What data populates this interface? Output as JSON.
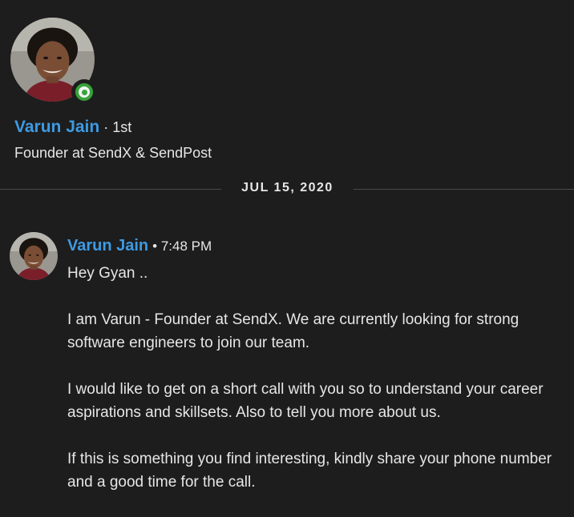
{
  "profile": {
    "name": "Varun Jain",
    "degree": "· 1st",
    "headline": "Founder at SendX & SendPost",
    "presence": "online"
  },
  "conversation": {
    "date": "JUL 15, 2020",
    "message": {
      "sender": "Varun Jain",
      "time": "• 7:48 PM",
      "paragraphs": [
        "Hey Gyan ..",
        "I am Varun - Founder at SendX. We are currently looking for strong software engineers to join our team.",
        "I would like to get on a short call with you so to understand your career aspirations and skillsets. Also to tell you more about us.",
        "If this is something you find interesting, kindly share your phone number and a good time for the call."
      ]
    }
  },
  "colors": {
    "background": "#1d1d1d",
    "link": "#3e9ae2",
    "presence_green": "#37a33b",
    "divider": "#4a4a4a"
  },
  "icons": {
    "presence": "online-status-icon"
  }
}
